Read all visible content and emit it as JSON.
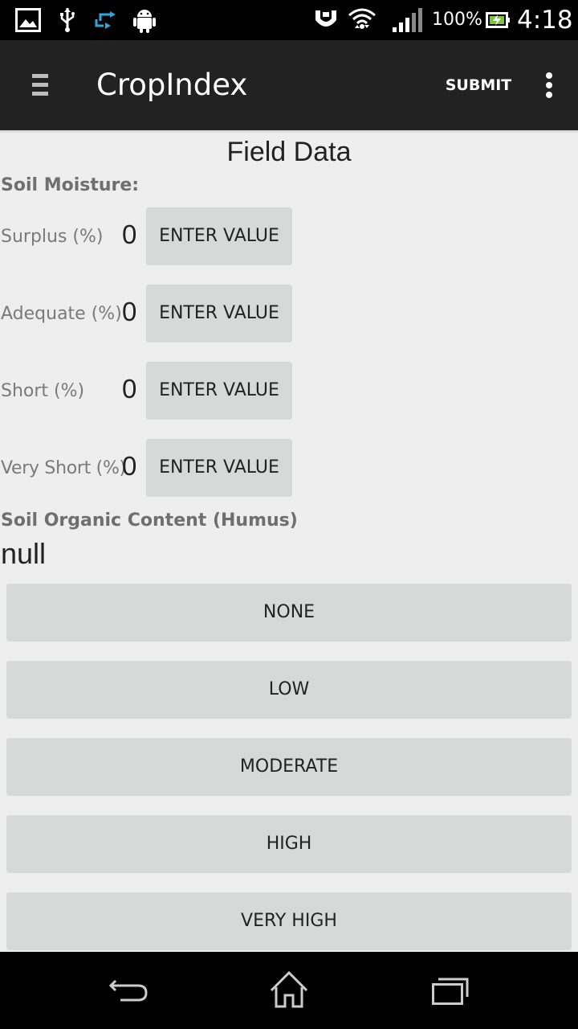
{
  "status_bar": {
    "battery_percent": "100%",
    "time": "4:18",
    "icons": [
      "gallery-icon",
      "usb-icon",
      "transfer-icon",
      "android-icon",
      "nfc-icon",
      "wifi-icon",
      "signal-icon",
      "battery-icon"
    ]
  },
  "action_bar": {
    "title": "CropIndex",
    "submit_label": "SUBMIT",
    "menu_icon": "hamburger-icon",
    "overflow_icon": "overflow-menu-icon"
  },
  "page": {
    "title": "Field Data"
  },
  "soil_moisture": {
    "heading": "Soil Moisture:",
    "rows": [
      {
        "label": "Surplus (%)",
        "value": "0",
        "button": "ENTER VALUE"
      },
      {
        "label": "Adequate (%)",
        "value": "0",
        "button": "ENTER VALUE"
      },
      {
        "label": "Short (%)",
        "value": "0",
        "button": "ENTER VALUE"
      },
      {
        "label": "Very Short (%)",
        "value": "0",
        "button": "ENTER VALUE"
      }
    ]
  },
  "organic_content": {
    "heading": "Soil Organic Content (Humus)",
    "value": "null",
    "options": [
      "NONE",
      "LOW",
      "MODERATE",
      "HIGH",
      "VERY HIGH"
    ]
  },
  "nav_bar": {
    "icons": [
      "back-icon",
      "home-icon",
      "recents-icon"
    ]
  }
}
